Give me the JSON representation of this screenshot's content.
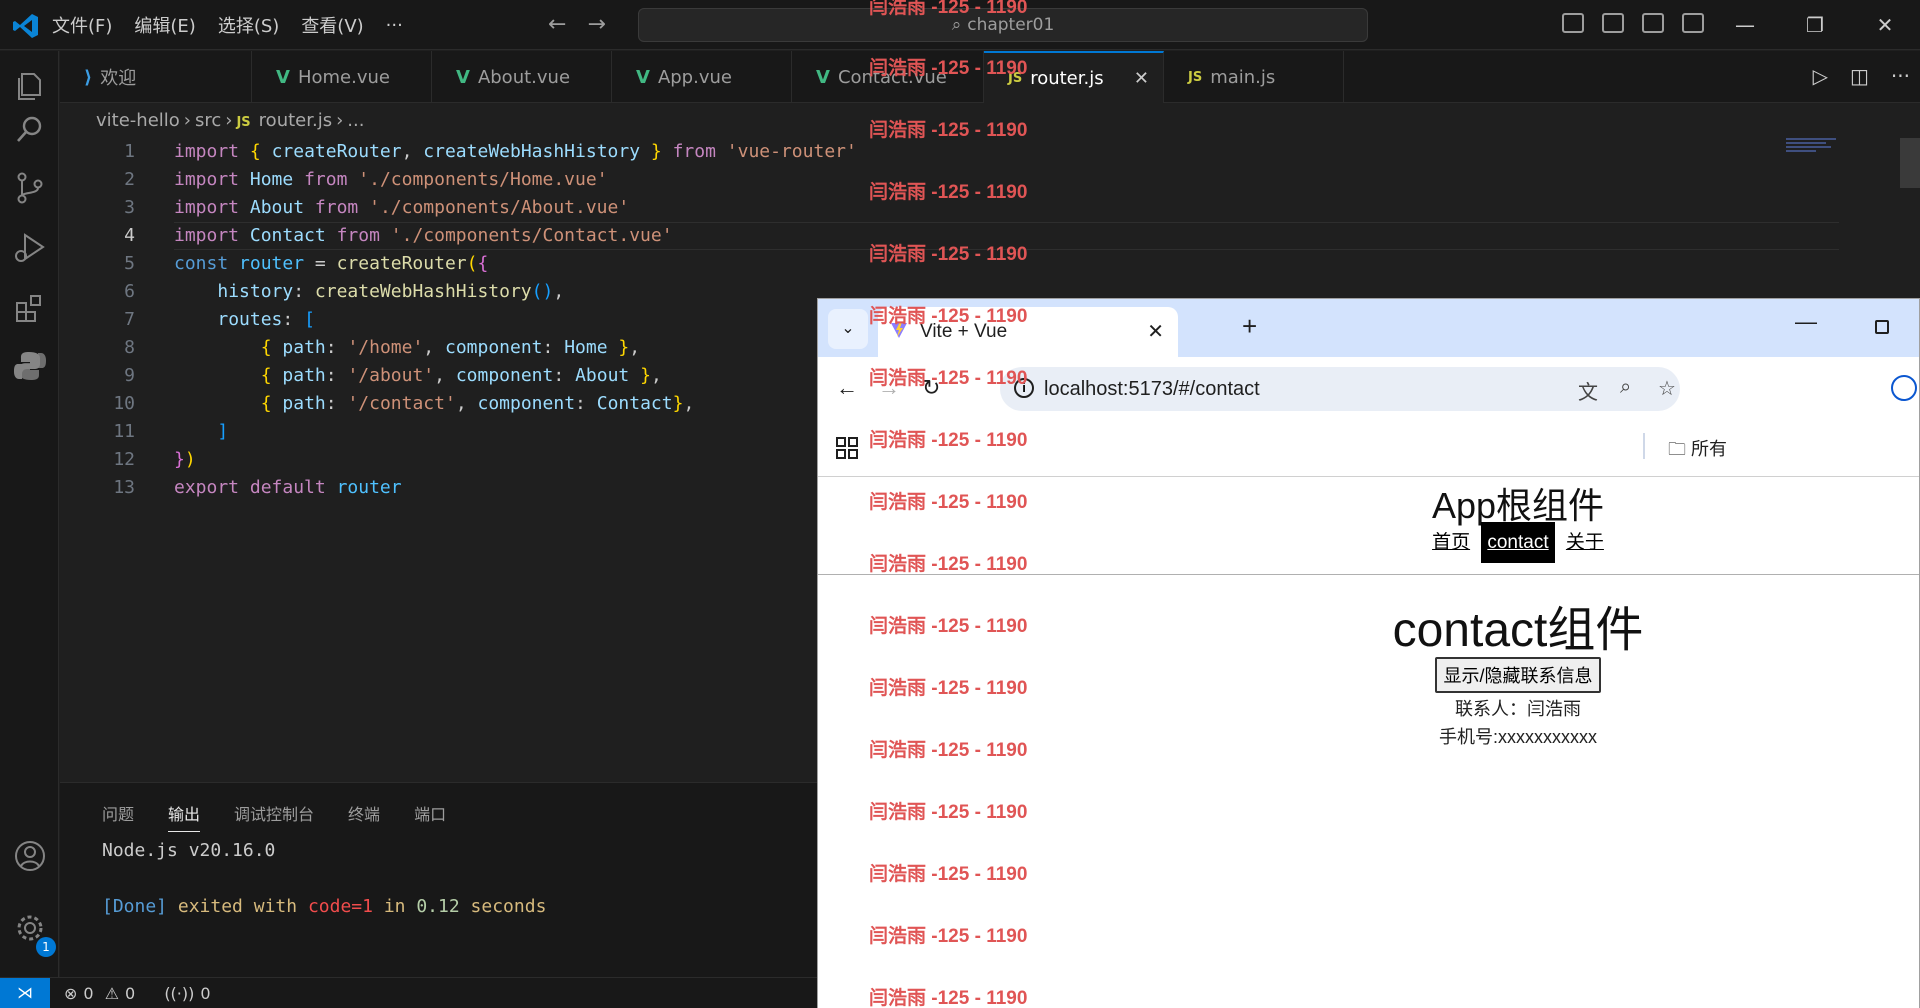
{
  "titlebar": {
    "menu": [
      "文件(F)",
      "编辑(E)",
      "选择(S)",
      "查看(V)",
      "···"
    ],
    "search_text": "chapter01"
  },
  "tabs": [
    {
      "label": "欢迎",
      "icon": "vscode-icon"
    },
    {
      "label": "Home.vue",
      "icon": "vue-icon"
    },
    {
      "label": "About.vue",
      "icon": "vue-icon"
    },
    {
      "label": "App.vue",
      "icon": "vue-icon"
    },
    {
      "label": "Contact.vue",
      "icon": "vue-icon"
    },
    {
      "label": "router.js",
      "icon": "js-icon",
      "active": true
    },
    {
      "label": "main.js",
      "icon": "js-icon"
    }
  ],
  "breadcrumb": {
    "root": "vite-hello",
    "folder": "src",
    "file": "router.js",
    "tail": "..."
  },
  "editor": {
    "current_line": 4,
    "line_numbers": [
      "1",
      "2",
      "3",
      "4",
      "5",
      "6",
      "7",
      "8",
      "9",
      "10",
      "11",
      "12",
      "13"
    ]
  },
  "panel": {
    "tabs": [
      "问题",
      "输出",
      "调试控制台",
      "终端",
      "端口"
    ],
    "active_tab": "输出",
    "output_node": "Node.js v20.16.0",
    "done_tag": "[Done]",
    "exited_text": "exited with",
    "code_text": "code=1",
    "in_text": "in",
    "seconds_value": "0.12",
    "seconds_text": "seconds"
  },
  "statusbar": {
    "errors": "0",
    "warnings": "0",
    "ports": "0",
    "badge": "1"
  },
  "watermark": "闫浩雨 -125 - 1190",
  "browser": {
    "tab_title": "Vite + Vue",
    "url": "localhost:5173/#/contact",
    "bookmarks_label": "所有",
    "page": {
      "app_title": "App根组件",
      "nav": [
        "首页",
        "contact",
        "关于"
      ],
      "active_nav": "contact",
      "component_title": "contact组件",
      "toggle_button": "显示/隐藏联系信息",
      "contact_person": "联系人：闫浩雨",
      "phone": "手机号:xxxxxxxxxxx"
    }
  },
  "colors": {
    "accent": "#0078d4",
    "vue_green": "#41b883",
    "watermark_red": "#e05555"
  }
}
